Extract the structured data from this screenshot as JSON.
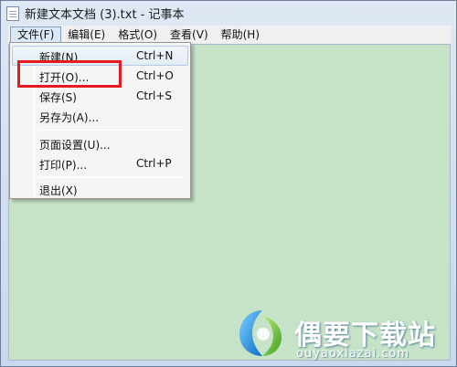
{
  "window": {
    "title": "新建文本文档 (3).txt - 记事本"
  },
  "menu": {
    "items": [
      {
        "label": "文件(F)"
      },
      {
        "label": "编辑(E)"
      },
      {
        "label": "格式(O)"
      },
      {
        "label": "查看(V)"
      },
      {
        "label": "帮助(H)"
      }
    ]
  },
  "file_menu": {
    "items": [
      {
        "label": "新建(N)",
        "shortcut": "Ctrl+N"
      },
      {
        "label": "打开(O)...",
        "shortcut": "Ctrl+O"
      },
      {
        "label": "保存(S)",
        "shortcut": "Ctrl+S"
      },
      {
        "label": "另存为(A)...",
        "shortcut": ""
      },
      {
        "label": "页面设置(U)...",
        "shortcut": ""
      },
      {
        "label": "打印(P)...",
        "shortcut": "Ctrl+P"
      },
      {
        "label": "退出(X)",
        "shortcut": ""
      }
    ]
  },
  "watermark": {
    "title": "偶要下载站",
    "subtitle": "ouyaoxiazai.com"
  },
  "colors": {
    "highlight": "#e5191e",
    "editor_bg": "#c7e3c7"
  }
}
